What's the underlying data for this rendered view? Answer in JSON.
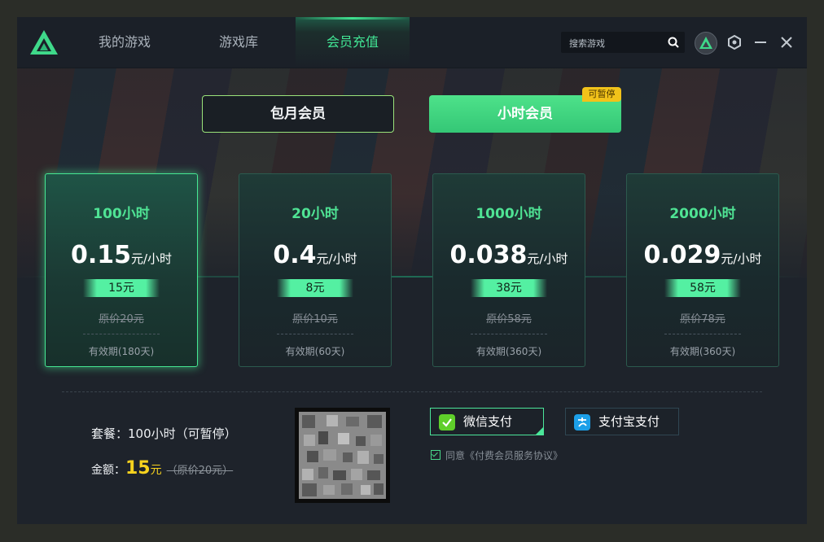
{
  "nav": {
    "tabs": [
      {
        "label": "我的游戏"
      },
      {
        "label": "游戏库"
      },
      {
        "label": "会员充值",
        "active": true
      }
    ],
    "search_placeholder": "搜索游戏"
  },
  "membership": {
    "monthly_label": "包月会员",
    "hourly_label": "小时会员",
    "pause_tag": "可暂停",
    "selected_type": "小时会员"
  },
  "plans": [
    {
      "title": "100小时",
      "price": "0.15",
      "unit": "元/小时",
      "badge": "15元",
      "original": "原价20元",
      "validity": "有效期(180天)",
      "selected": true
    },
    {
      "title": "20小时",
      "price": "0.4",
      "unit": "元/小时",
      "badge": "8元",
      "original": "原价10元",
      "validity": "有效期(60天)",
      "selected": false
    },
    {
      "title": "1000小时",
      "price": "0.038",
      "unit": "元/小时",
      "badge": "38元",
      "original": "原价58元",
      "validity": "有效期(360天)",
      "selected": false
    },
    {
      "title": "2000小时",
      "price": "0.029",
      "unit": "元/小时",
      "badge": "58元",
      "original": "原价78元",
      "validity": "有效期(360天)",
      "selected": false
    }
  ],
  "order": {
    "package_text": "套餐：100小时（可暂停）",
    "amount_label": "金额：",
    "amount_value": "15",
    "amount_unit": "元",
    "amount_original": "（原价20元）"
  },
  "payment": {
    "wechat_label": "微信支付",
    "alipay_label": "支付宝支付",
    "selected": "微信支付",
    "agreement_text": "同意《付费会员服务协议》",
    "agreement_checked": true
  },
  "colors": {
    "accent": "#42e695",
    "price_highlight": "#f7d21e",
    "pause_tag": "#f2c21a"
  },
  "icons": [
    "logo-icon",
    "search-icon",
    "avatar",
    "settings-icon",
    "minimize-icon",
    "close-icon",
    "wechat-pay-icon",
    "alipay-icon",
    "checkbox-checked-icon"
  ]
}
